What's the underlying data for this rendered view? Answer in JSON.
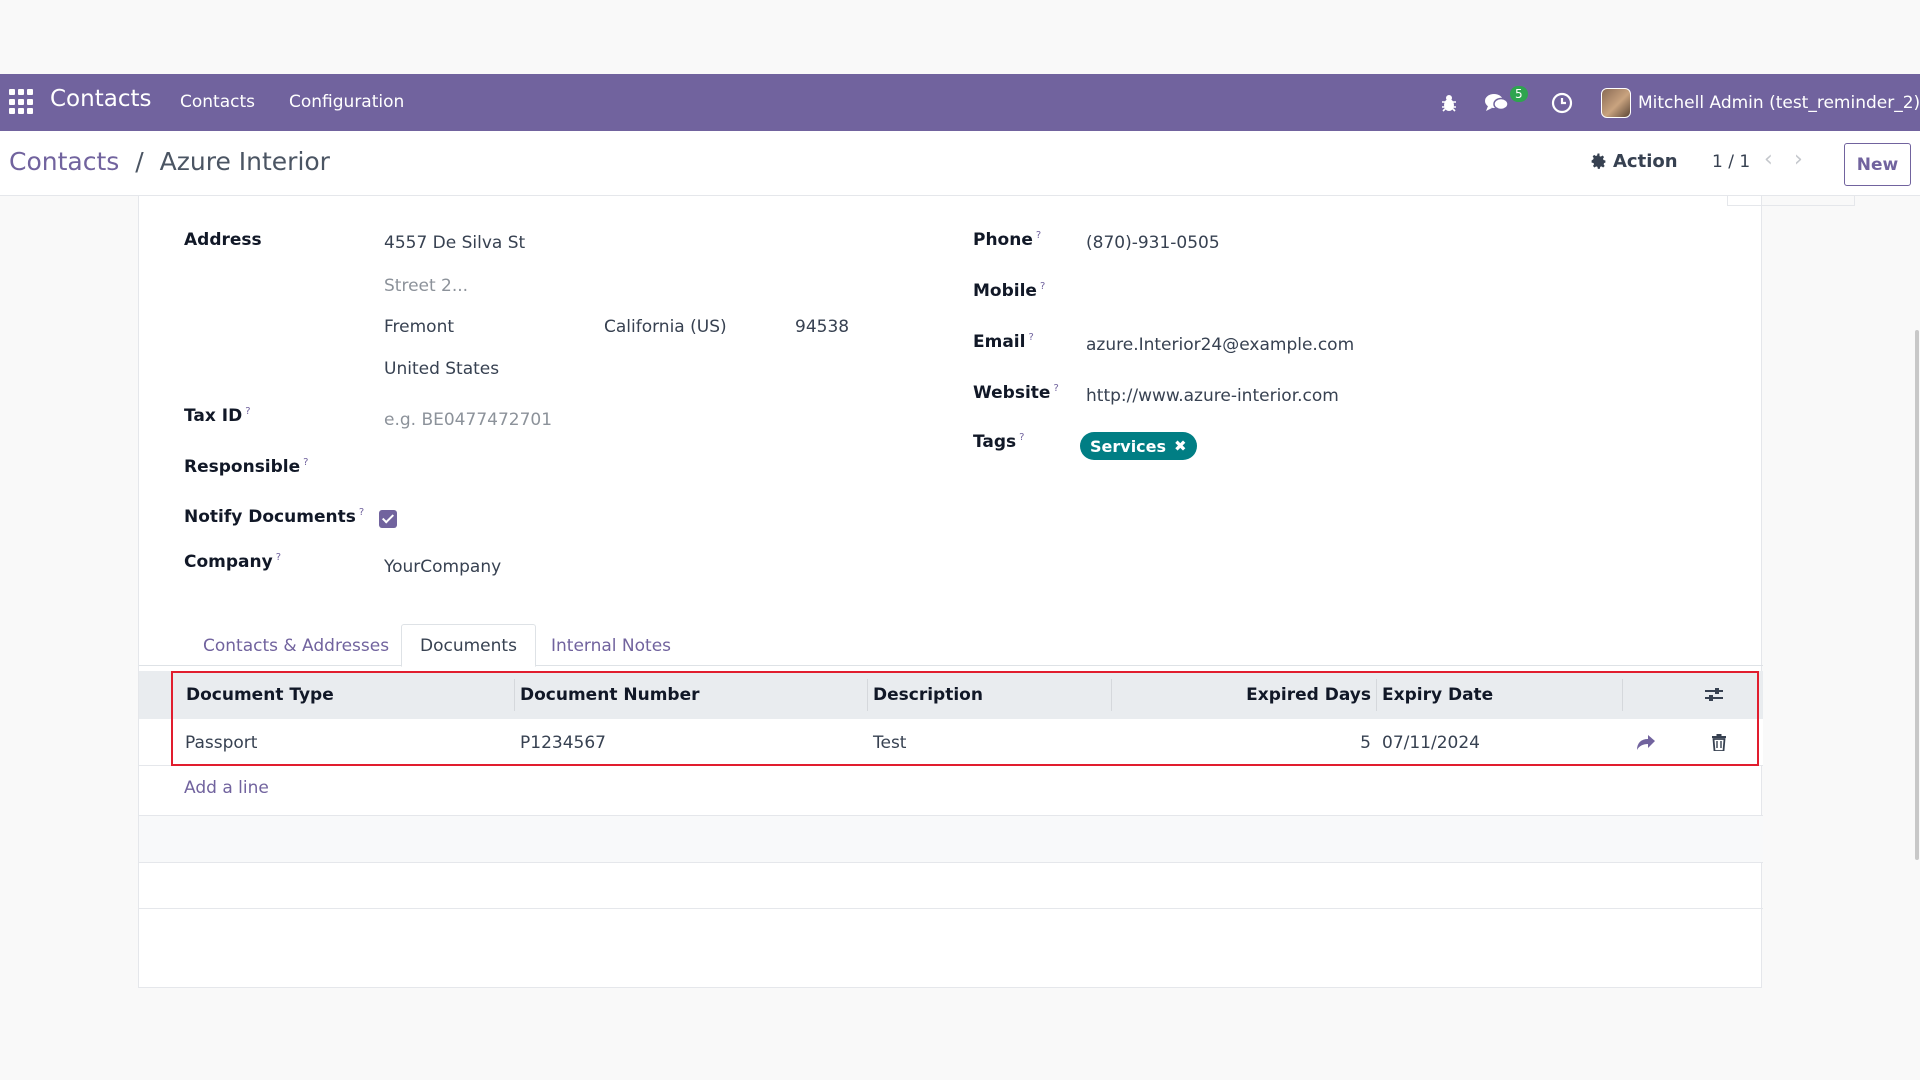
{
  "navbar": {
    "brand": "Contacts",
    "menu": [
      "Contacts",
      "Configuration"
    ],
    "messages_badge": "5",
    "user": "Mitchell Admin (test_reminder_2)"
  },
  "control": {
    "breadcrumb_parent": "Contacts",
    "breadcrumb_sep": "/",
    "breadcrumb_current": "Azure Interior",
    "action_label": "Action",
    "pager": "1 / 1",
    "new_label": "New"
  },
  "form": {
    "address_label": "Address",
    "street": "4557 De Silva St",
    "street2_placeholder": "Street 2...",
    "city": "Fremont",
    "state": "California (US)",
    "zip": "94538",
    "country": "United States",
    "tax_id_label": "Tax ID",
    "tax_id_placeholder": "e.g. BE0477472701",
    "responsible_label": "Responsible",
    "notify_label": "Notify Documents",
    "company_label": "Company",
    "company": "YourCompany",
    "phone_label": "Phone",
    "phone": "(870)-931-0505",
    "mobile_label": "Mobile",
    "email_label": "Email",
    "email": "azure.Interior24@example.com",
    "website_label": "Website",
    "website": "http://www.azure-interior.com",
    "tags_label": "Tags",
    "tag": "Services",
    "help_mark": "?"
  },
  "tabs": [
    "Contacts & Addresses",
    "Documents",
    "Internal Notes"
  ],
  "documents": {
    "columns": [
      "Document Type",
      "Document Number",
      "Description",
      "Expired Days",
      "Expiry Date"
    ],
    "rows": [
      {
        "type": "Passport",
        "number": "P1234567",
        "description": "Test",
        "expired_days": "5",
        "expiry_date": "07/11/2024"
      }
    ],
    "add_line": "Add a line"
  },
  "colors": {
    "brand": "#71639e",
    "tag": "#017e84",
    "highlight": "#e11d2e"
  },
  "icons": [
    "apps-grid-icon",
    "bug-icon",
    "chat-icon",
    "clock-icon",
    "gear-icon",
    "chevron-left-icon",
    "chevron-right-icon",
    "close-icon",
    "column-settings-icon",
    "share-icon",
    "trash-icon"
  ]
}
